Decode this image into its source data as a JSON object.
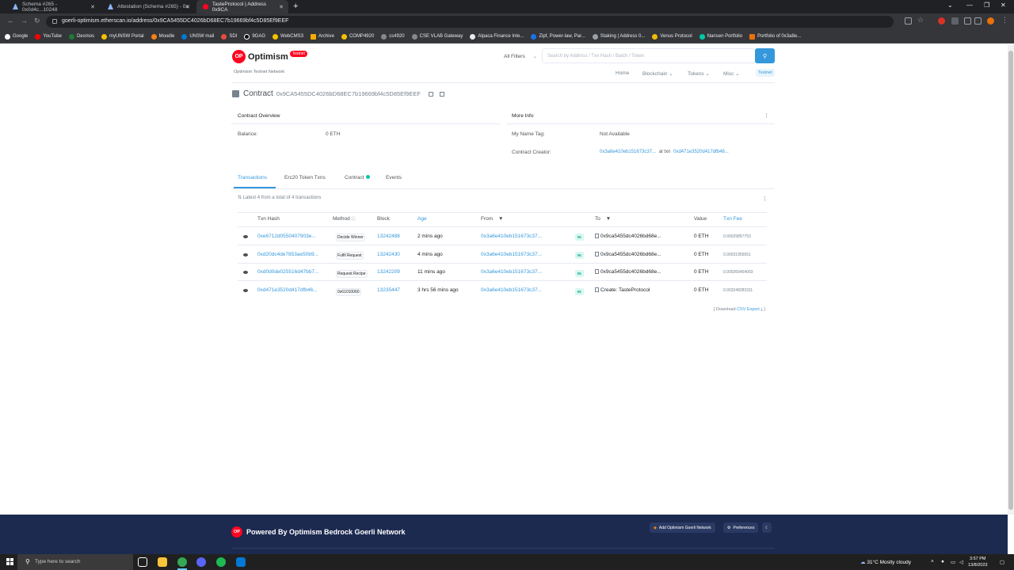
{
  "browser": {
    "tabs": [
      {
        "label": "Schema #265 - 0x0d4c...10248",
        "active": false
      },
      {
        "label": "Attestation (Schema #265) - 0x",
        "active": false
      },
      {
        "label": "TasteProtocol | Address 0x9CA",
        "active": true
      }
    ],
    "url": "goerli-optimism.etherscan.io/address/0x9CA5455DC4026bD68EC7b19669bf4c5D85Ef9EEF",
    "bookmarks": [
      "Google",
      "YouTube",
      "Desmos",
      "myUNSW Portal",
      "Moodle",
      "UNSW mail",
      "SDI",
      "9GAG",
      "WebCMS3",
      "Archive",
      "COMP4920",
      "cs4920",
      "CSE VLAB Gateway",
      "Alpaca Finance Inte...",
      "Zipf, Power-law, Par...",
      "Staking | Address 0...",
      "Venus Protocol",
      "Nansen Portfolio",
      "Portfolio of 0x3a8e..."
    ]
  },
  "site": {
    "logo_text": "Optimism",
    "logo_pill": "Testnet",
    "network_label": "Optimism Testnet Network",
    "filter_label": "All Filters",
    "search_placeholder": "Search by Address / Txn Hash / Batch / Token",
    "nav": [
      "Home",
      "Blockchain",
      "Tokens",
      "Misc"
    ],
    "testnet_label": "Testnet"
  },
  "contract": {
    "title": "Contract",
    "address": "0x9CA5455DC4026bD68EC7b19669bf4c5D85Ef9EEF",
    "overview_label": "Contract Overview",
    "balance_label": "Balance:",
    "balance_value": "0 ETH",
    "more_info_label": "More Info",
    "name_tag_label": "My Name Tag:",
    "name_tag_value": "Not Available",
    "creator_label": "Contract Creator:",
    "creator_address": "0x3a6e410eb151673c37...",
    "creator_at": "at txn",
    "creator_txn": "0xd471e3520d417dfb46..."
  },
  "tabs": [
    "Transactions",
    "Erc20 Token Txns",
    "Contract",
    "Events"
  ],
  "transactions": {
    "summary": "Latest 4 from a total of 4 transactions",
    "headers": [
      "Txn Hash",
      "Method",
      "Block",
      "Age",
      "From",
      "To",
      "Value",
      "Txn Fee"
    ],
    "rows": [
      {
        "hash": "0xe6712d0550407903e...",
        "method": "Decide Winner",
        "block": "13242488",
        "age": "2 mins ago",
        "from": "0x3a6e410eb151673c37...",
        "dir": "IN",
        "to": "0x9ca5455dc4026bd68e...",
        "value": "0 ETH",
        "fee": "0.00029857753"
      },
      {
        "hash": "0xd20dc4de7853ae50b9...",
        "method": "Fulfil Request",
        "block": "13242430",
        "age": "4 mins ago",
        "from": "0x3a6e410eb151673c37...",
        "dir": "IN",
        "to": "0x9ca5455dc4026bd68e...",
        "value": "0 ETH",
        "fee": "0.00031955651"
      },
      {
        "hash": "0xd0d0de025516d47bb7...",
        "method": "Request Recipe",
        "block": "13242209",
        "age": "11 mins ago",
        "from": "0x3a6e410eb151673c37...",
        "dir": "IN",
        "to": "0x9ca5455dc4026bd68e...",
        "value": "0 ETH",
        "fee": "0.000266464093"
      },
      {
        "hash": "0xd471e3520d417dfb46...",
        "method": "0x61010060",
        "block": "13235447",
        "age": "3 hrs 56 mins ago",
        "from": "0x3a6e410eb151673c37...",
        "dir": "IN",
        "to": "Create: TasteProtocol",
        "value": "0 ETH",
        "fee": "0.003248283311"
      }
    ],
    "download_prefix": "[ Download",
    "download_link": "CSV Export",
    "download_suffix": "]"
  },
  "footer": {
    "powered_by": "Powered By Optimism Bedrock Goerli Network",
    "add_network": "Add Optimism Goerli Network",
    "preferences": "Preferences"
  },
  "taskbar": {
    "search_placeholder": "Type here to search",
    "weather": "31°C  Mostly cloudy",
    "time": "3:57 PM",
    "date": "13/8/2023"
  }
}
